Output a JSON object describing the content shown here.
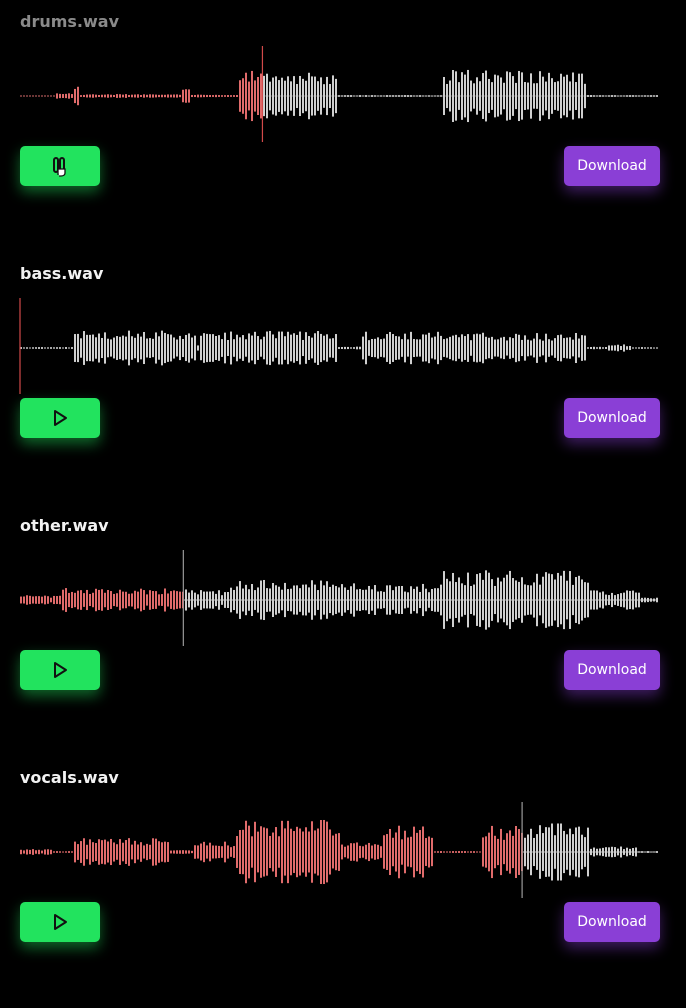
{
  "colors": {
    "played": "#e06b6b",
    "unplayed": "#cfcfcf",
    "baseline_played": "#d46a6a",
    "baseline_unplayed": "#bdbdbd",
    "playhead_active": "#d24a4a",
    "playhead": "#9a9a9a",
    "play_button": "#22e35e",
    "download_button": "#8a3fd6"
  },
  "tracks": [
    {
      "filename": "drums.wav",
      "state": "playing",
      "progress": 0.38,
      "play_icon": "pause-icon",
      "download_label": "Download"
    },
    {
      "filename": "bass.wav",
      "state": "paused",
      "progress": 0.0,
      "play_icon": "play-icon",
      "download_label": "Download"
    },
    {
      "filename": "other.wav",
      "state": "paused",
      "progress": 0.256,
      "play_icon": "play-icon",
      "download_label": "Download"
    },
    {
      "filename": "vocals.wav",
      "state": "paused",
      "progress": 0.787,
      "play_icon": "play-icon",
      "download_label": "Download"
    }
  ]
}
